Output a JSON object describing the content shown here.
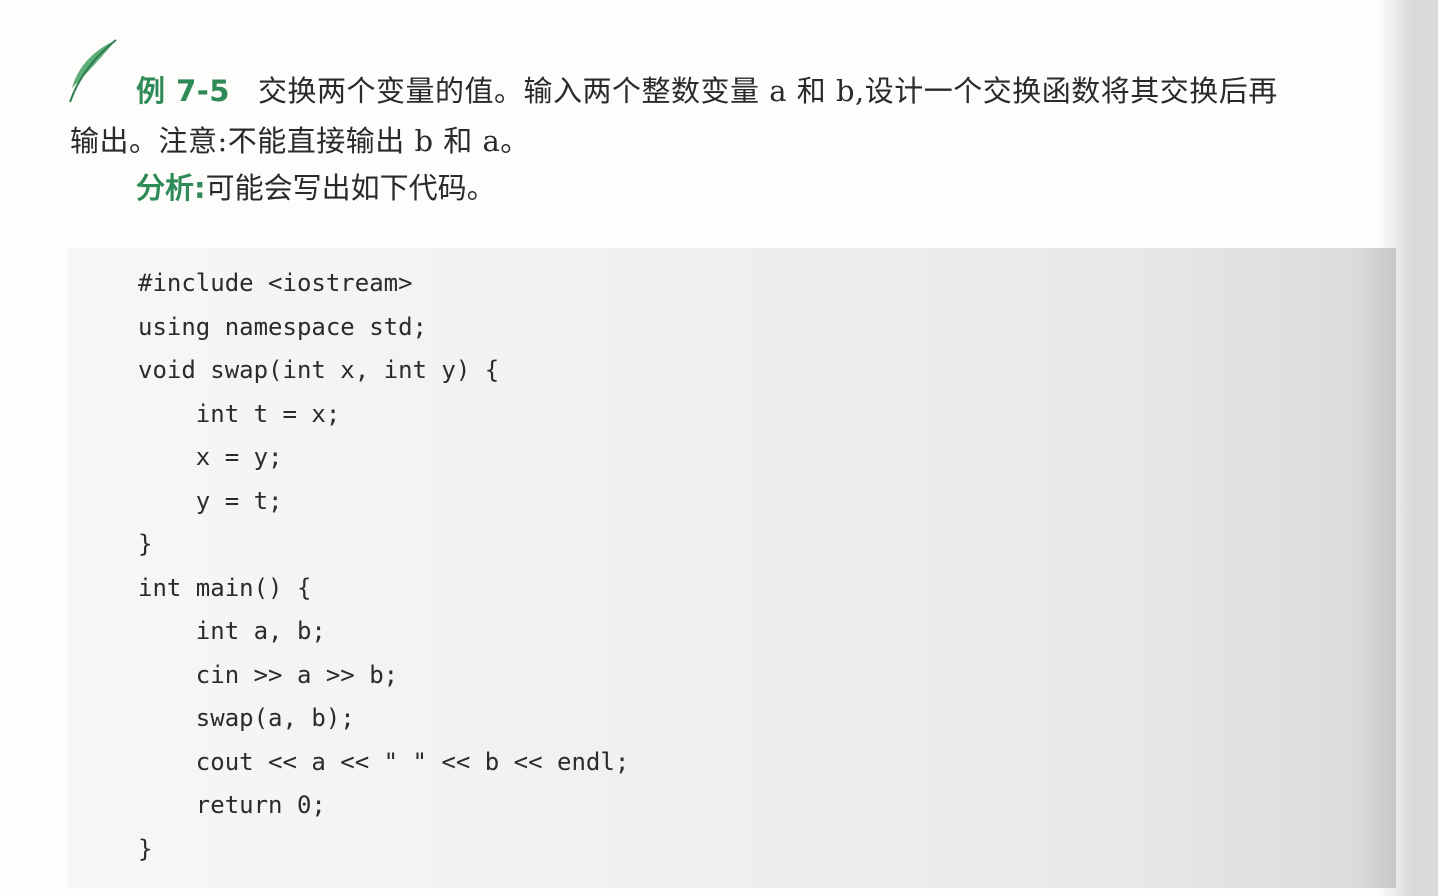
{
  "problem": {
    "example_label": "例 7-5",
    "line1_text": "交换两个变量的值。输入两个整数变量 a 和 b,设计一个交换函数将其交换后再",
    "line2_text": "输出。注意:不能直接输出 b 和 a。"
  },
  "analysis": {
    "label": "分析:",
    "text": "可能会写出如下代码。"
  },
  "code_lines": [
    "#include <iostream>",
    "using namespace std;",
    "void swap(int x, int y) {",
    "    int t = x;",
    "    x = y;",
    "    y = t;",
    "}",
    "int main() {",
    "    int a, b;",
    "    cin >> a >> b;",
    "    swap(a, b);",
    "    cout << a << \" \" << b << endl;",
    "    return 0;",
    "}"
  ],
  "icons": {
    "leaf": "leaf-icon"
  },
  "colors": {
    "accent_green": "#2e8b57"
  }
}
